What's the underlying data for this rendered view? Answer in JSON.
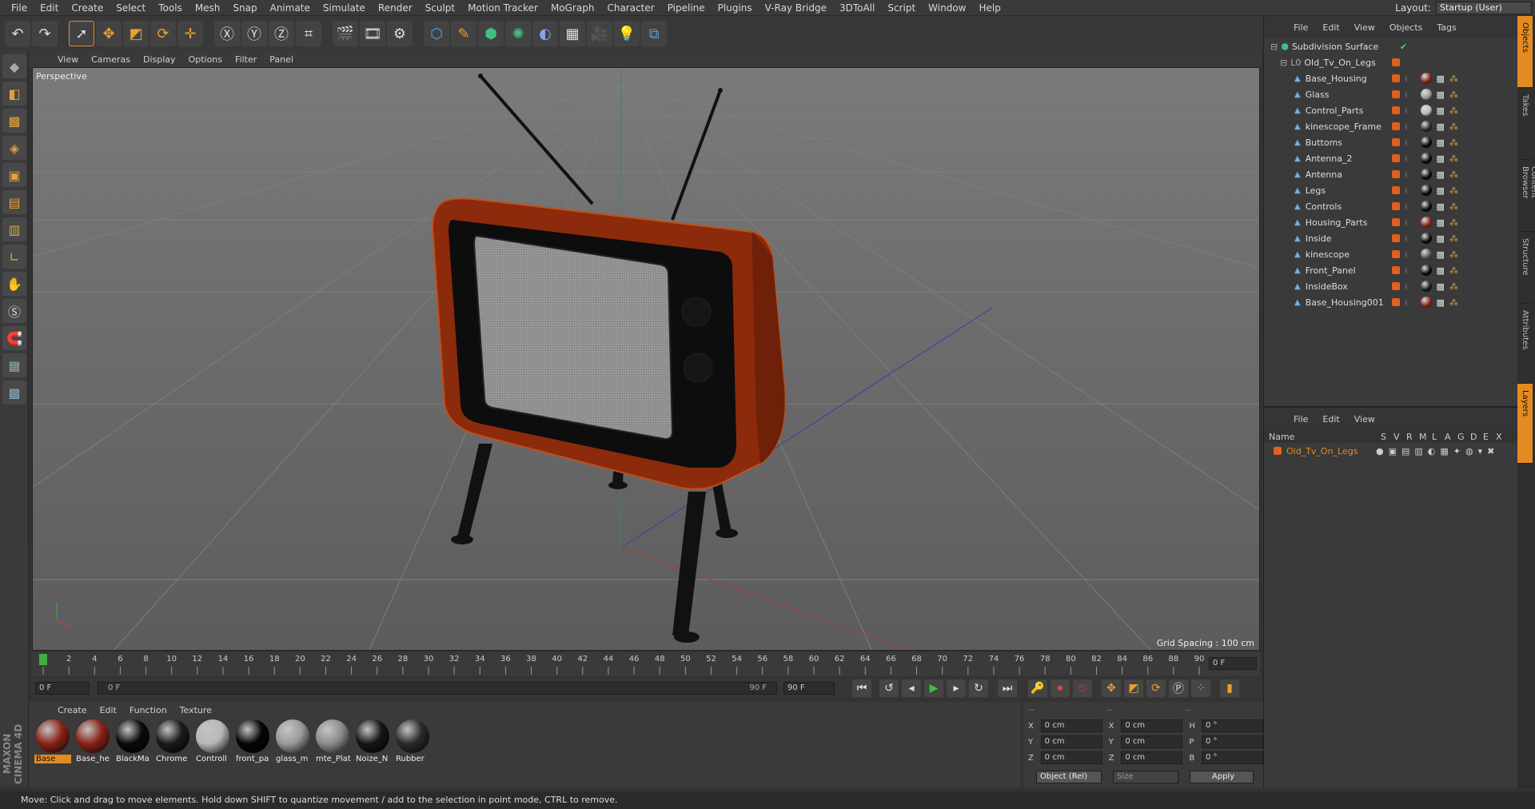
{
  "menubar": {
    "items": [
      "File",
      "Edit",
      "Create",
      "Select",
      "Tools",
      "Mesh",
      "Snap",
      "Animate",
      "Simulate",
      "Render",
      "Sculpt",
      "Motion Tracker",
      "MoGraph",
      "Character",
      "Pipeline",
      "Plugins",
      "V-Ray Bridge",
      "3DToAll",
      "Script",
      "Window",
      "Help"
    ],
    "layout_label": "Layout:",
    "layout_value": "Startup (User)"
  },
  "viewport": {
    "menu": [
      "View",
      "Cameras",
      "Display",
      "Options",
      "Filter",
      "Panel"
    ],
    "label": "Perspective",
    "grid_spacing": "Grid Spacing : 100 cm"
  },
  "timeline": {
    "ticks": [
      "0",
      "2",
      "4",
      "6",
      "8",
      "10",
      "12",
      "14",
      "16",
      "18",
      "20",
      "22",
      "24",
      "26",
      "28",
      "30",
      "32",
      "34",
      "36",
      "38",
      "40",
      "42",
      "44",
      "46",
      "48",
      "50",
      "52",
      "54",
      "56",
      "58",
      "60",
      "62",
      "64",
      "66",
      "68",
      "70",
      "72",
      "74",
      "76",
      "78",
      "80",
      "82",
      "84",
      "86",
      "88",
      "90"
    ],
    "current_frame": "0 F",
    "start_frame": "0 F",
    "range_start": "0 F",
    "range_end": "90 F",
    "end_frame": "90 F"
  },
  "materials": {
    "menu": [
      "Create",
      "Edit",
      "Function",
      "Texture"
    ],
    "items": [
      {
        "name": "Base",
        "color": "#8a2318",
        "selected": true
      },
      {
        "name": "Base_he",
        "color": "#8a2318",
        "selected": false
      },
      {
        "name": "BlackMa",
        "color": "#0a0a0a",
        "selected": false
      },
      {
        "name": "Chrome",
        "color": "#1a1a1a",
        "selected": false
      },
      {
        "name": "Controll",
        "color": "#b8b8b8",
        "selected": false
      },
      {
        "name": "front_pa",
        "color": "#050505",
        "selected": false
      },
      {
        "name": "glass_m",
        "color": "#9a9a9a",
        "selected": false
      },
      {
        "name": "mte_Plat",
        "color": "#8c8c8c",
        "selected": false
      },
      {
        "name": "Noize_N",
        "color": "#151515",
        "selected": false
      },
      {
        "name": "Rubber",
        "color": "#2a2a2a",
        "selected": false
      }
    ]
  },
  "coordinates": {
    "header": [
      "--",
      "--",
      "--"
    ],
    "rows": [
      {
        "a": "X",
        "av": "0 cm",
        "b": "X",
        "bv": "0 cm",
        "c": "H",
        "cv": "0 °"
      },
      {
        "a": "Y",
        "av": "0 cm",
        "b": "Y",
        "bv": "0 cm",
        "c": "P",
        "cv": "0 °"
      },
      {
        "a": "Z",
        "av": "0 cm",
        "b": "Z",
        "bv": "0 cm",
        "c": "B",
        "cv": "0 °"
      }
    ],
    "mode": "Object (Rel)",
    "size": "Size",
    "apply": "Apply"
  },
  "objects": {
    "menu": [
      "File",
      "Edit",
      "View",
      "Objects",
      "Tags"
    ],
    "root": "Subdivision Surface",
    "group": "Old_Tv_On_Legs",
    "items": [
      {
        "name": "Base_Housing",
        "mat": "#8a2318"
      },
      {
        "name": "Glass",
        "mat": "#9a9a9a"
      },
      {
        "name": "Control_Parts",
        "mat": "#b8b8b8"
      },
      {
        "name": "kinescope_Frame",
        "mat": "#2a2a2a"
      },
      {
        "name": "Buttoms",
        "mat": "#0a0a0a"
      },
      {
        "name": "Antenna_2",
        "mat": "#0a0a0a"
      },
      {
        "name": "Antenna",
        "mat": "#0a0a0a"
      },
      {
        "name": "Legs",
        "mat": "#0a0a0a"
      },
      {
        "name": "Controls",
        "mat": "#0a0a0a"
      },
      {
        "name": "Housing_Parts",
        "mat": "#8a2318"
      },
      {
        "name": "Inside",
        "mat": "#0a0a0a"
      },
      {
        "name": "kinescope",
        "mat": "#555555"
      },
      {
        "name": "Front_Panel",
        "mat": "#0a0a0a"
      },
      {
        "name": "InsideBox",
        "mat": "#1a1a1a"
      },
      {
        "name": "Base_Housing001",
        "mat": "#8a2318"
      }
    ]
  },
  "layers": {
    "menu": [
      "File",
      "Edit",
      "View"
    ],
    "columns": [
      "Name",
      "S",
      "V",
      "R",
      "M",
      "L",
      "A",
      "G",
      "D",
      "E",
      "X"
    ],
    "row": "Old_Tv_On_Legs"
  },
  "sidetabs": [
    "Objects",
    "Takes",
    "Content Browser",
    "Structure",
    "Attributes",
    "Layers"
  ],
  "status": "Move: Click and drag to move elements. Hold down SHIFT to quantize movement / add to the selection in point mode, CTRL to remove.",
  "brand": "MAXON CINEMA 4D",
  "colors": {
    "accent": "#e38b23",
    "tv_body": "#a8380f"
  }
}
